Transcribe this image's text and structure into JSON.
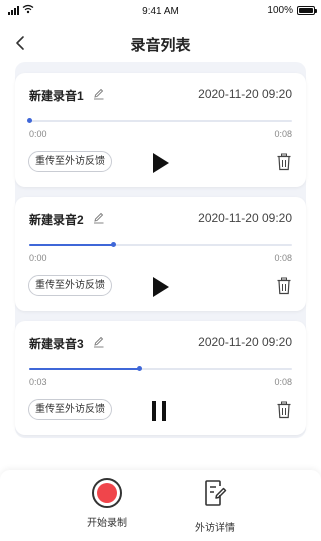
{
  "status_bar": {
    "time": "9:41 AM",
    "battery": "100%"
  },
  "nav": {
    "title": "录音列表"
  },
  "recordings": [
    {
      "name": "新建录音1",
      "date": "2020-11-20 09:20",
      "current": "0:00",
      "duration": "0:08",
      "progress": 0.0,
      "resend_label": "重传至外访反馈",
      "state": "play"
    },
    {
      "name": "新建录音2",
      "date": "2020-11-20 09:20",
      "current": "0:00",
      "duration": "0:08",
      "progress": 0.32,
      "resend_label": "重传至外访反馈",
      "state": "play"
    },
    {
      "name": "新建录音3",
      "date": "2020-11-20 09:20",
      "current": "0:03",
      "duration": "0:08",
      "progress": 0.42,
      "resend_label": "重传至外访反馈",
      "state": "pause"
    }
  ],
  "bottom": {
    "record_label": "开始录制",
    "detail_label": "外访详情"
  },
  "colors": {
    "accent": "#3f67d8",
    "record": "#f0454b",
    "list_bg": "#f1f3f8"
  }
}
